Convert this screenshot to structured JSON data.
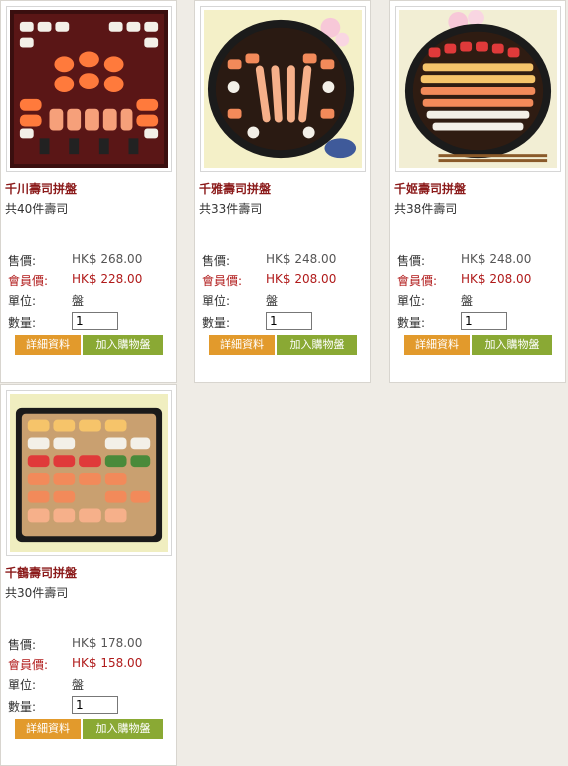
{
  "labels": {
    "price": "售價:",
    "member_price": "會員價:",
    "unit": "單位:",
    "quantity": "數量:",
    "details_button": "詳細資料",
    "add_cart_button": "加入購物盤"
  },
  "products": [
    {
      "name": "千川壽司拼盤",
      "desc": "共40件壽司",
      "price": "HK$ 268.00",
      "member_price": "HK$ 228.00",
      "unit": "盤",
      "qty": "1",
      "image": "sushi-platter-square"
    },
    {
      "name": "千雅壽司拼盤",
      "desc": "共33件壽司",
      "price": "HK$ 248.00",
      "member_price": "HK$ 208.00",
      "unit": "盤",
      "qty": "1",
      "image": "sushi-platter-round-shrimp"
    },
    {
      "name": "千姬壽司拼盤",
      "desc": "共38件壽司",
      "price": "HK$ 248.00",
      "member_price": "HK$ 208.00",
      "unit": "盤",
      "qty": "1",
      "image": "sushi-platter-round"
    },
    {
      "name": "千鶴壽司拼盤",
      "desc": "共30件壽司",
      "price": "HK$ 178.00",
      "member_price": "HK$ 158.00",
      "unit": "盤",
      "qty": "1",
      "image": "sushi-platter-box"
    }
  ],
  "colors": {
    "name": "#8b1a1a",
    "member": "#b01a1a",
    "detail_btn": "#e29a2c",
    "cart_btn": "#8aa934",
    "background": "#efece6"
  }
}
